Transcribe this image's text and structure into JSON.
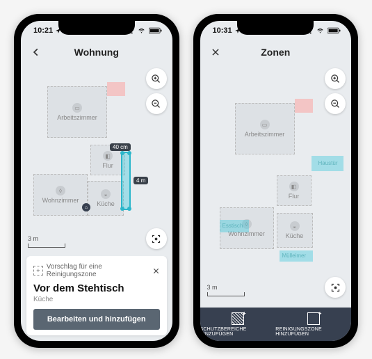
{
  "phone1": {
    "time": "10:21",
    "title": "Wohnung",
    "rooms": {
      "arbeitszimmer": "Arbeitszimmer",
      "flur": "Flur",
      "wohnzimmer": "Wohnzimmer",
      "kueche": "Küche"
    },
    "dim_w": "40 cm",
    "dim_h": "4 m",
    "scale": "3 m",
    "card": {
      "lead": "Vorschlag für eine Reinigungszone",
      "title": "Vor dem Stehtisch",
      "sub": "Küche",
      "button": "Bearbeiten und hinzufügen"
    }
  },
  "phone2": {
    "time": "10:31",
    "title": "Zonen",
    "rooms": {
      "arbeitszimmer": "Arbeitszimmer",
      "flur": "Flur",
      "wohnzimmer": "Wohnzimmer",
      "kueche": "Küche"
    },
    "zones": {
      "haustuer": "Haustür",
      "esstisch": "Esstisch",
      "muelleimer": "Mülleimer"
    },
    "scale": "3 m",
    "bar": {
      "protect": "SCHUTZBEREICHE HINZUFÜGEN",
      "clean": "REINIGUNGSZONE HINZUFÜGEN"
    }
  }
}
